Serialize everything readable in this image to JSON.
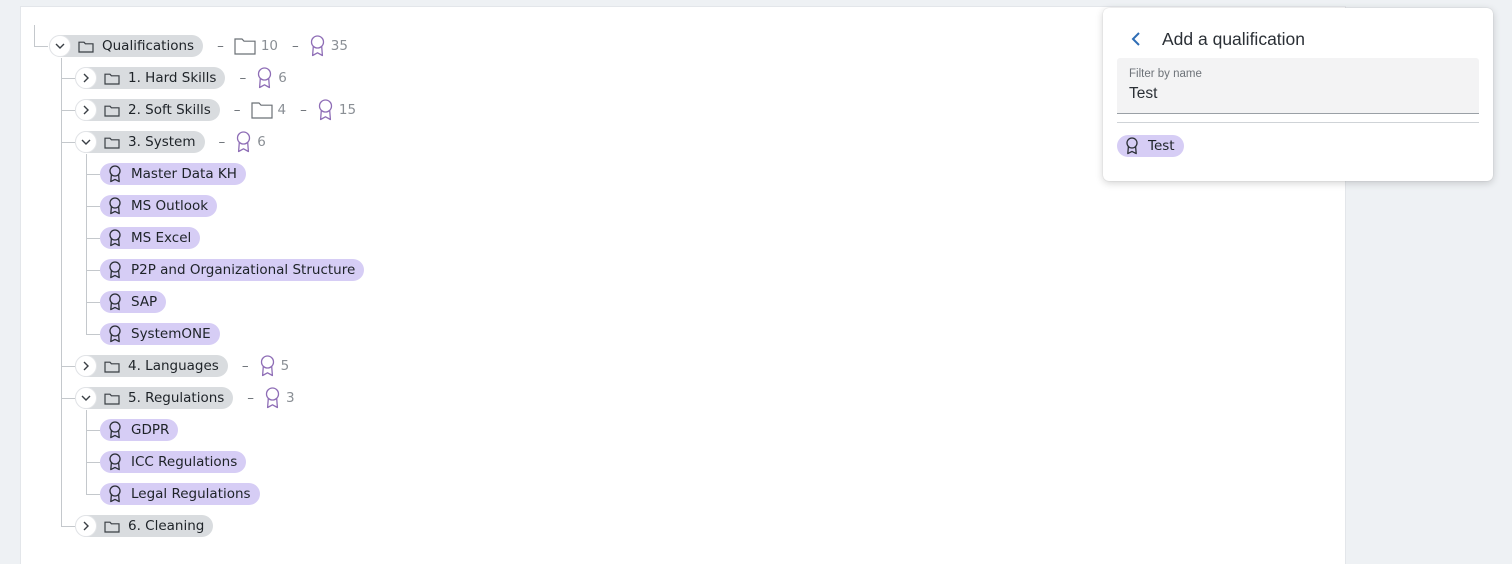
{
  "tree": {
    "root": {
      "label": "Qualifications",
      "folder_count": "10",
      "qual_count": "35"
    },
    "groups": [
      {
        "label": "1. Hard Skills",
        "qual_count": "6"
      },
      {
        "label": "2. Soft Skills",
        "folder_count": "4",
        "qual_count": "15"
      },
      {
        "label": "3. System",
        "qual_count": "6",
        "items": [
          "Master Data KH",
          "MS Outlook",
          "MS Excel",
          "P2P and Organizational Structure",
          "SAP",
          "SystemONE"
        ]
      },
      {
        "label": "4. Languages",
        "qual_count": "5"
      },
      {
        "label": "5. Regulations",
        "qual_count": "3",
        "items": [
          "GDPR",
          "ICC Regulations",
          "Legal Regulations"
        ]
      },
      {
        "label": "6. Cleaning"
      }
    ],
    "separator": "–"
  },
  "panel": {
    "title": "Add a qualification",
    "filter_label": "Filter by name",
    "filter_value": "Test",
    "results": [
      "Test"
    ]
  },
  "colors": {
    "folder_pill": "#d9dcdf",
    "qualification_pill": "#d6cdf5",
    "qualification_icon": "#7a5fb0",
    "back_arrow": "#2f6db5"
  },
  "icons": [
    "chevron-down-icon",
    "chevron-right-icon",
    "folder-icon",
    "award-ribbon-icon",
    "back-arrow-icon"
  ]
}
